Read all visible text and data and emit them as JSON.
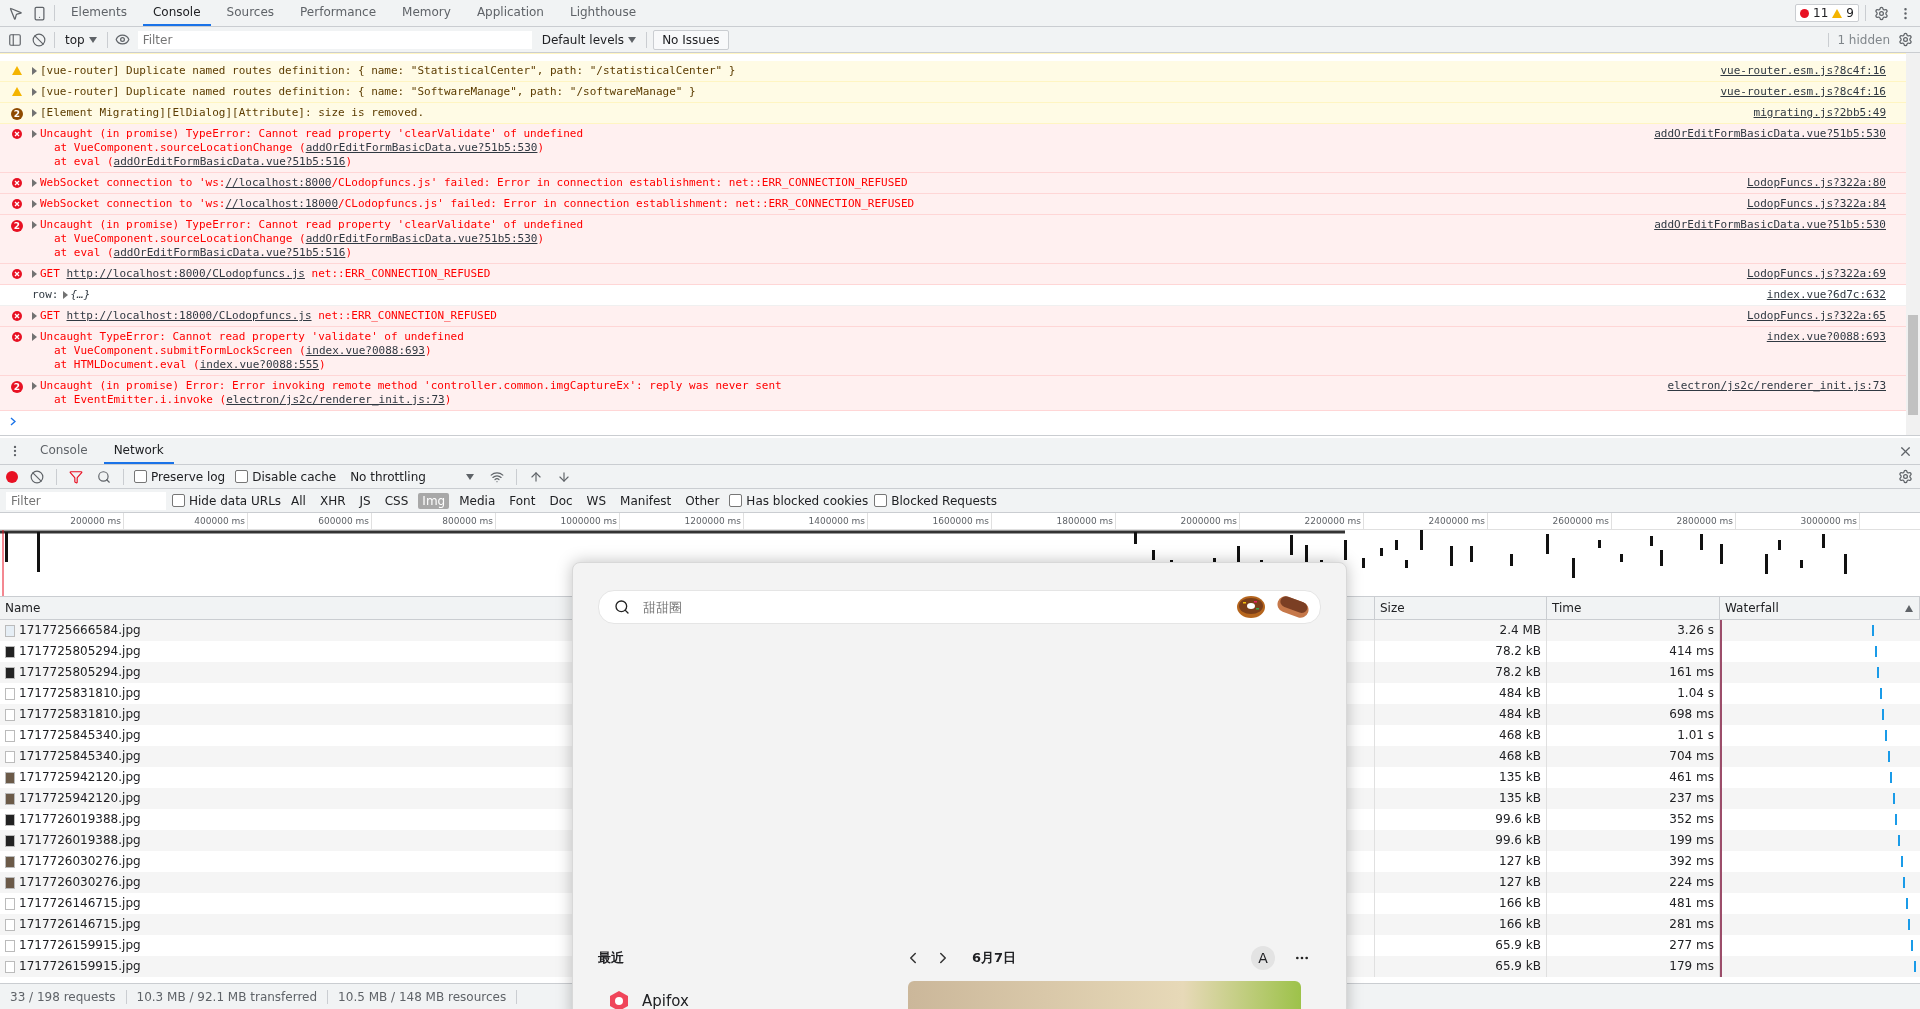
{
  "devtools_tabs": [
    {
      "label": "Elements",
      "selected": false
    },
    {
      "label": "Console",
      "selected": true
    },
    {
      "label": "Sources",
      "selected": false
    },
    {
      "label": "Performance",
      "selected": false
    },
    {
      "label": "Memory",
      "selected": false
    },
    {
      "label": "Application",
      "selected": false
    },
    {
      "label": "Lighthouse",
      "selected": false
    }
  ],
  "counters": {
    "errors": "11",
    "warnings": "9"
  },
  "console_toolbar": {
    "context": "top",
    "filter_placeholder": "Filter",
    "levels": "Default levels",
    "issues": "No Issues",
    "hidden": "1 hidden"
  },
  "messages": [
    {
      "kind": "warning",
      "lines": [
        [
          {
            "text": "[vue-router] Duplicate named routes definition: { name: \"StatisticalCenter\", path: \"/statisticalCenter\" }"
          }
        ]
      ],
      "source": "vue-router.esm.js?8c4f:16"
    },
    {
      "kind": "warning",
      "lines": [
        [
          {
            "text": "[vue-router] Duplicate named routes definition: { name: \"SoftwareManage\", path: \"/softwareManage\" }"
          }
        ]
      ],
      "source": "vue-router.esm.js?8c4f:16"
    },
    {
      "kind": "warning",
      "count": "2",
      "lines": [
        [
          {
            "text": "[Element Migrating][ElDialog][Attribute]: size is removed."
          }
        ]
      ],
      "source": "migrating.js?2bb5:49"
    },
    {
      "kind": "error",
      "lines": [
        [
          {
            "text": "Uncaught (in promise) TypeError: Cannot read property 'clearValidate' of undefined"
          }
        ],
        [
          {
            "text": "at VueComponent.sourceLocationChange ("
          },
          {
            "link": "addOrEditFormBasicData.vue?51b5:530"
          },
          {
            "text": ")"
          }
        ],
        [
          {
            "text": "at eval ("
          },
          {
            "link": "addOrEditFormBasicData.vue?51b5:516"
          },
          {
            "text": ")"
          }
        ]
      ],
      "source": "addOrEditFormBasicData.vue?51b5:530"
    },
    {
      "kind": "error",
      "lines": [
        [
          {
            "text": "WebSocket connection to 'ws:"
          },
          {
            "link": "//localhost:8000"
          },
          {
            "text": "/CLodopfuncs.js' failed: Error in connection establishment: net::ERR_CONNECTION_REFUSED"
          }
        ]
      ],
      "source": "LodopFuncs.js?322a:80"
    },
    {
      "kind": "error",
      "lines": [
        [
          {
            "text": "WebSocket connection to 'ws:"
          },
          {
            "link": "//localhost:18000"
          },
          {
            "text": "/CLodopfuncs.js' failed: Error in connection establishment: net::ERR_CONNECTION_REFUSED"
          }
        ]
      ],
      "source": "LodopFuncs.js?322a:84"
    },
    {
      "kind": "error",
      "count": "2",
      "lines": [
        [
          {
            "text": "Uncaught (in promise) TypeError: Cannot read property 'clearValidate' of undefined"
          }
        ],
        [
          {
            "text": "at VueComponent.sourceLocationChange ("
          },
          {
            "link": "addOrEditFormBasicData.vue?51b5:530"
          },
          {
            "text": ")"
          }
        ],
        [
          {
            "text": "at eval ("
          },
          {
            "link": "addOrEditFormBasicData.vue?51b5:516"
          },
          {
            "text": ")"
          }
        ]
      ],
      "source": "addOrEditFormBasicData.vue?51b5:530"
    },
    {
      "kind": "error",
      "lines": [
        [
          {
            "text": "GET "
          },
          {
            "link": "http://localhost:8000/CLodopfuncs.js"
          },
          {
            "text": " net::ERR_CONNECTION_REFUSED"
          }
        ]
      ],
      "source": "LodopFuncs.js?322a:69"
    },
    {
      "kind": "log",
      "lines": [
        [
          {
            "text": "row:"
          },
          {
            "text": "{…}"
          }
        ]
      ],
      "source": "index.vue?6d7c:632"
    },
    {
      "kind": "error",
      "lines": [
        [
          {
            "text": "GET "
          },
          {
            "link": "http://localhost:18000/CLodopfuncs.js"
          },
          {
            "text": " net::ERR_CONNECTION_REFUSED"
          }
        ]
      ],
      "source": "LodopFuncs.js?322a:65"
    },
    {
      "kind": "error",
      "lines": [
        [
          {
            "text": "Uncaught TypeError: Cannot read property 'validate' of undefined"
          }
        ],
        [
          {
            "text": "at VueComponent.submitFormLockScreen ("
          },
          {
            "link": "index.vue?0088:693"
          },
          {
            "text": ")"
          }
        ],
        [
          {
            "text": "at HTMLDocument.eval ("
          },
          {
            "link": "index.vue?0088:555"
          },
          {
            "text": ")"
          }
        ]
      ],
      "source": "index.vue?0088:693"
    },
    {
      "kind": "error",
      "count": "2",
      "lines": [
        [
          {
            "text": "Uncaught (in promise) Error: Error invoking remote method 'controller.common.imgCaptureEx': reply was never sent"
          }
        ],
        [
          {
            "text": "at EventEmitter.i.invoke ("
          },
          {
            "link": "electron/js2c/renderer_init.js:73"
          },
          {
            "text": ")"
          }
        ]
      ],
      "source": "electron/js2c/renderer_init.js:73"
    }
  ],
  "drawer_tabs": [
    {
      "label": "Console",
      "selected": false
    },
    {
      "label": "Network",
      "selected": true
    }
  ],
  "network_toolbar": {
    "recording": true,
    "preserve_log": {
      "label": "Preserve log",
      "checked": false
    },
    "disable_cache": {
      "label": "Disable cache",
      "checked": false
    },
    "throttling": "No throttling"
  },
  "filter_bar": {
    "placeholder": "Filter",
    "hide_data_urls": {
      "label": "Hide data URLs",
      "checked": false
    },
    "types": [
      {
        "label": "All",
        "selected": false
      },
      {
        "label": "XHR",
        "selected": false
      },
      {
        "label": "JS",
        "selected": false
      },
      {
        "label": "CSS",
        "selected": false
      },
      {
        "label": "Img",
        "selected": true
      },
      {
        "label": "Media",
        "selected": false
      },
      {
        "label": "Font",
        "selected": false
      },
      {
        "label": "Doc",
        "selected": false
      },
      {
        "label": "WS",
        "selected": false
      },
      {
        "label": "Manifest",
        "selected": false
      },
      {
        "label": "Other",
        "selected": false
      }
    ],
    "has_blocked_cookies": {
      "label": "Has blocked cookies",
      "checked": false
    },
    "blocked_requests": {
      "label": "Blocked Requests",
      "checked": false
    }
  },
  "overview_ticks": [
    "200000 ms",
    "400000 ms",
    "600000 ms",
    "800000 ms",
    "1000000 ms",
    "1200000 ms",
    "1400000 ms",
    "1600000 ms",
    "1800000 ms",
    "2000000 ms",
    "2200000 ms",
    "2400000 ms",
    "2600000 ms",
    "2800000 ms",
    "3000000 ms"
  ],
  "table": {
    "columns": [
      "Name",
      "Size",
      "Time",
      "Waterfall"
    ],
    "rows": [
      {
        "kind": "broken",
        "name": "1717725666584.jpg",
        "size": "2.4 MB",
        "time": "3.26 s"
      },
      {
        "kind": "dark",
        "name": "1717725805294.jpg",
        "size": "78.2 kB",
        "time": "414 ms"
      },
      {
        "kind": "dark",
        "name": "1717725805294.jpg",
        "size": "78.2 kB",
        "time": "161 ms"
      },
      {
        "kind": "blank",
        "name": "1717725831810.jpg",
        "size": "484 kB",
        "time": "1.04 s"
      },
      {
        "kind": "blank",
        "name": "1717725831810.jpg",
        "size": "484 kB",
        "time": "698 ms"
      },
      {
        "kind": "blank",
        "name": "1717725845340.jpg",
        "size": "468 kB",
        "time": "1.01 s"
      },
      {
        "kind": "blank",
        "name": "1717725845340.jpg",
        "size": "468 kB",
        "time": "704 ms"
      },
      {
        "kind": "photo",
        "name": "1717725942120.jpg",
        "size": "135 kB",
        "time": "461 ms"
      },
      {
        "kind": "photo",
        "name": "1717725942120.jpg",
        "size": "135 kB",
        "time": "237 ms"
      },
      {
        "kind": "dark",
        "name": "1717726019388.jpg",
        "size": "99.6 kB",
        "time": "352 ms"
      },
      {
        "kind": "dark",
        "name": "1717726019388.jpg",
        "size": "99.6 kB",
        "time": "199 ms"
      },
      {
        "kind": "photo",
        "name": "1717726030276.jpg",
        "size": "127 kB",
        "time": "392 ms"
      },
      {
        "kind": "photo",
        "name": "1717726030276.jpg",
        "size": "127 kB",
        "time": "224 ms"
      },
      {
        "kind": "blank",
        "name": "1717726146715.jpg",
        "size": "166 kB",
        "time": "481 ms"
      },
      {
        "kind": "blank",
        "name": "1717726146715.jpg",
        "size": "166 kB",
        "time": "281 ms"
      },
      {
        "kind": "blank",
        "name": "1717726159915.jpg",
        "size": "65.9 kB",
        "time": "277 ms"
      },
      {
        "kind": "blank",
        "name": "1717726159915.jpg",
        "size": "65.9 kB",
        "time": "179 ms"
      }
    ]
  },
  "status_bar": [
    "33 / 198 requests",
    "10.3 MB / 92.1 MB transferred",
    "10.5 MB / 148 MB resources"
  ],
  "search_panel": {
    "placeholder": "甜甜圈",
    "recent_title": "最近",
    "date": "6月7日",
    "avatar": "A",
    "recent_apps": [
      "Apifox"
    ]
  }
}
